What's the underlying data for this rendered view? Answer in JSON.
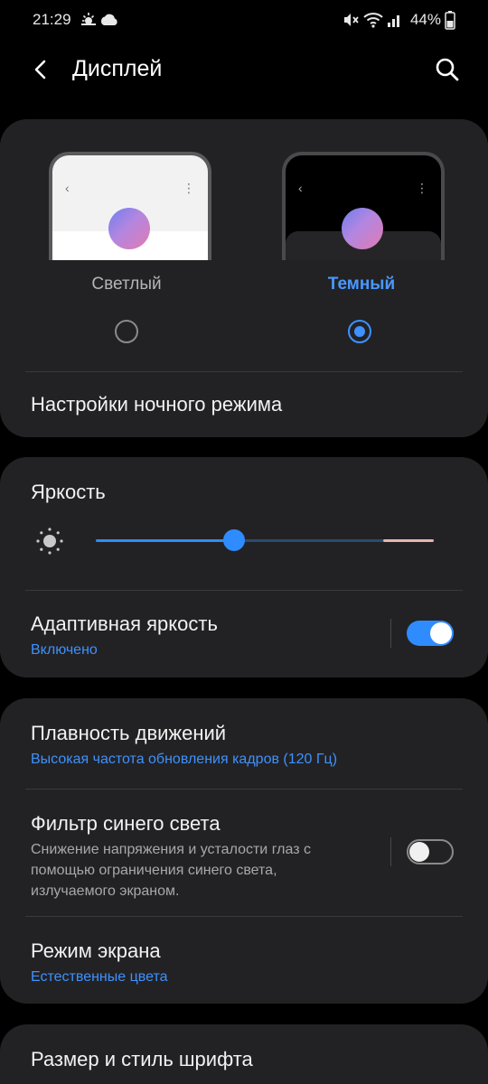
{
  "status": {
    "time": "21:29",
    "battery": "44%"
  },
  "header": {
    "title": "Дисплей"
  },
  "theme": {
    "light_label": "Светлый",
    "dark_label": "Темный",
    "selected": "dark",
    "night_settings": "Настройки ночного режима"
  },
  "brightness": {
    "title": "Яркость",
    "level_fraction": 0.41,
    "adaptive_title": "Адаптивная яркость",
    "adaptive_status": "Включено",
    "adaptive_on": true
  },
  "display": {
    "motion_title": "Плавность движений",
    "motion_sub": "Высокая частота обновления кадров (120 Гц)",
    "bluelight_title": "Фильтр синего света",
    "bluelight_desc": "Снижение напряжения и усталости глаз с помощью ограничения синего света, излучаемого экраном.",
    "bluelight_on": false,
    "screen_mode_title": "Режим экрана",
    "screen_mode_sub": "Естественные цвета"
  },
  "font": {
    "title": "Размер и стиль шрифта"
  },
  "colors": {
    "accent": "#3e91ff",
    "card": "#222224",
    "background": "#000000"
  },
  "icons": [
    "weather-sun-cloud-icon",
    "cloud-icon",
    "mute-icon",
    "wifi-icon",
    "signal-icon",
    "battery-icon",
    "back-arrow-icon",
    "search-icon",
    "sun-icon"
  ]
}
